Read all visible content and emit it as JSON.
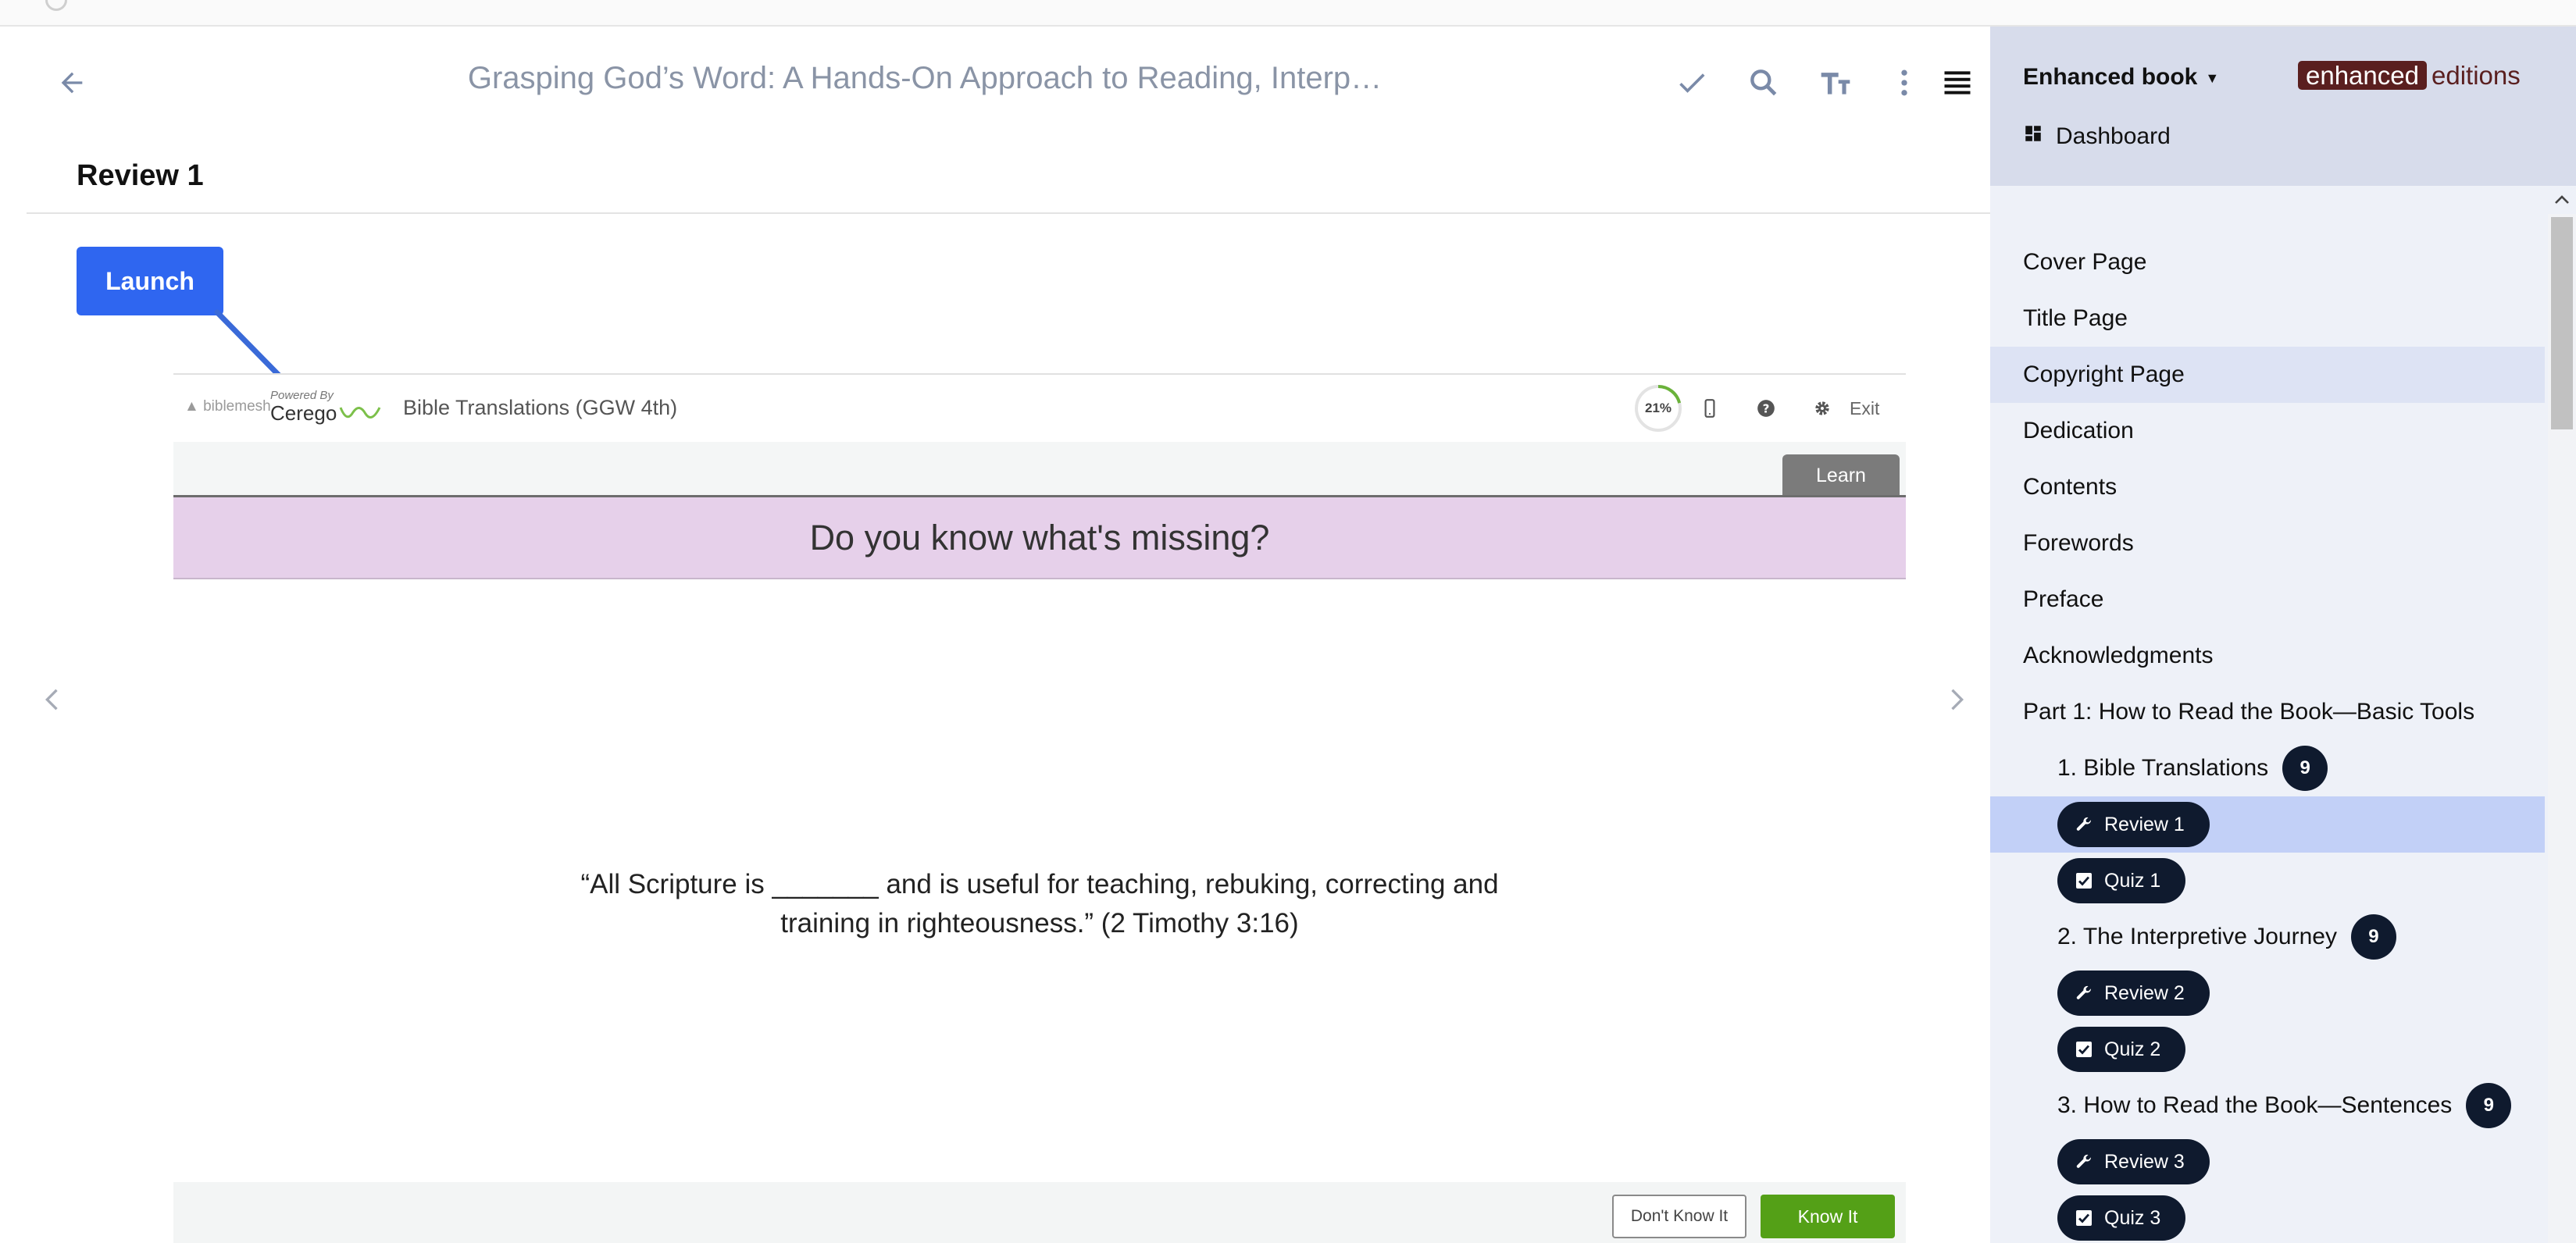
{
  "reader": {
    "book_title": "Grasping God’s Word: A Hands-On Approach to Reading, Interp…",
    "page_heading": "Review 1",
    "launch_label": "Launch"
  },
  "embed": {
    "biblemesh_logo": "biblemesh",
    "powered_by": "Powered By",
    "cerego": "Cerego",
    "deck_name": "Bible Translations (GGW 4th)",
    "progress": "21%",
    "progress_fraction": 0.21,
    "exit_label": "Exit",
    "learn_label": "Learn",
    "question": "Do you know what's missing?",
    "quote_line1": "“All Scripture is _______ and is useful for teaching, rebuking, correcting and",
    "quote_line2": "training in righteousness.” (2 Timothy 3:16)",
    "dont_know_label": "Don't Know It",
    "know_it_label": "Know It"
  },
  "sidebar": {
    "book_menu_label": "Enhanced book",
    "brand_part1": "enhanced",
    "brand_part2": "editions",
    "dashboard_label": "Dashboard",
    "toc": {
      "cover": "Cover Page",
      "title": "Title Page",
      "copyright": "Copyright Page",
      "dedication": "Dedication",
      "contents": "Contents",
      "forewords": "Forewords",
      "preface": "Preface",
      "acknowledgments": "Acknowledgments",
      "part1": "Part 1: How to Read the Book—Basic Tools",
      "ch1": "1. Bible Translations",
      "ch1_badge": "9",
      "review1": "Review 1",
      "quiz1": "Quiz 1",
      "ch2": "2. The Interpretive Journey",
      "ch2_badge": "9",
      "review2": "Review 2",
      "quiz2": "Quiz 2",
      "ch3": "3. How to Read the Book—Sentences",
      "ch3_badge": "9",
      "review3": "Review 3",
      "quiz3": "Quiz 3"
    }
  },
  "colors": {
    "launch_blue": "#2f66f0",
    "know_green": "#54a017",
    "banner_purple": "#e6d0ea",
    "pill_navy": "#0f1a2e",
    "active_row": "#c2d0f7",
    "brand_maroon": "#5a1f1f"
  }
}
